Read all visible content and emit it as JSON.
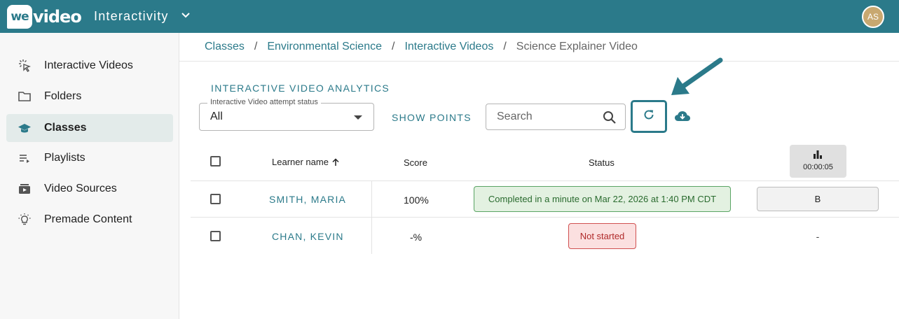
{
  "header": {
    "logo_badge": "we",
    "logo_text": "video",
    "app_title": "Interactivity",
    "avatar_initials": "AS",
    "brand_color": "#2b7a8a"
  },
  "sidebar": {
    "items": [
      {
        "label": "Interactive Videos",
        "icon": "click-pointer-icon",
        "active": false
      },
      {
        "label": "Folders",
        "icon": "folder-icon",
        "active": false
      },
      {
        "label": "Classes",
        "icon": "graduation-cap-icon",
        "active": true
      },
      {
        "label": "Playlists",
        "icon": "playlist-icon",
        "active": false
      },
      {
        "label": "Video Sources",
        "icon": "video-source-icon",
        "active": false
      },
      {
        "label": "Premade Content",
        "icon": "lightbulb-icon",
        "active": false
      }
    ]
  },
  "breadcrumb": {
    "items": [
      "Classes",
      "Environmental Science",
      "Interactive Videos"
    ],
    "separator": "/",
    "current": "Science Explainer Video"
  },
  "analytics": {
    "title": "INTERACTIVE VIDEO ANALYTICS",
    "status_filter": {
      "legend": "Interactive Video attempt status",
      "value": "All"
    },
    "show_points_label": "SHOW POINTS",
    "search_placeholder": "Search"
  },
  "table": {
    "headers": {
      "learner": "Learner name",
      "score": "Score",
      "status": "Status",
      "question_time": "00:00:05"
    },
    "rows": [
      {
        "learner": "SMITH, MARIA",
        "score": "100%",
        "status": "Completed in a minute on Mar 22, 2026 at 1:40 PM CDT",
        "status_type": "completed",
        "answer": "B"
      },
      {
        "learner": "CHAN, KEVIN",
        "score": "-%",
        "status": "Not started",
        "status_type": "not-started",
        "answer": "-"
      }
    ]
  }
}
